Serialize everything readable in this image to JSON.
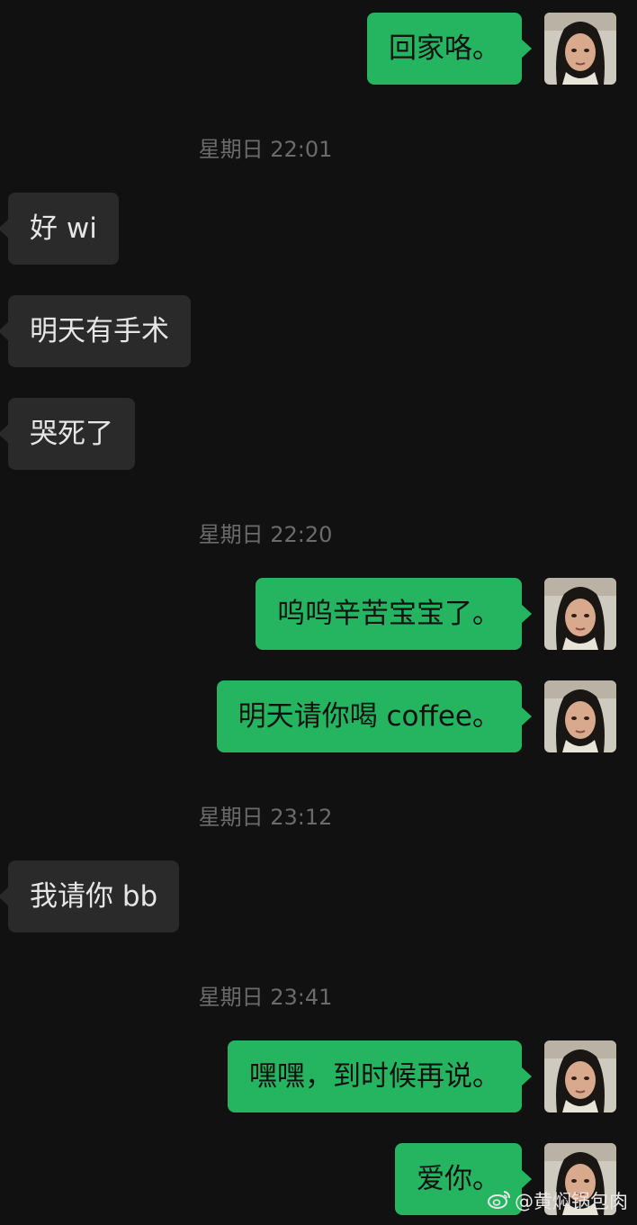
{
  "messages": [
    {
      "side": "out",
      "text": "回家咯。"
    },
    {
      "time": "星期日 22:01"
    },
    {
      "side": "in",
      "text": "好 wi"
    },
    {
      "side": "in",
      "text": "明天有手术"
    },
    {
      "side": "in",
      "text": "哭死了"
    },
    {
      "time": "星期日 22:20"
    },
    {
      "side": "out",
      "text": "呜呜辛苦宝宝了。"
    },
    {
      "side": "out",
      "text": "明天请你喝 coffee。"
    },
    {
      "time": "星期日 23:12"
    },
    {
      "side": "in",
      "text": "我请你 bb"
    },
    {
      "time": "星期日 23:41"
    },
    {
      "side": "out",
      "text": "嘿嘿，到时候再说。"
    },
    {
      "side": "out",
      "text": "爱你。"
    }
  ],
  "watermark": {
    "icon": "weibo-icon",
    "text": "@黄焖锅包肉"
  },
  "colors": {
    "background": "#111111",
    "outgoing_bubble": "#25b560",
    "incoming_bubble": "#2a2a2a",
    "timestamp": "#6b6b6b"
  }
}
